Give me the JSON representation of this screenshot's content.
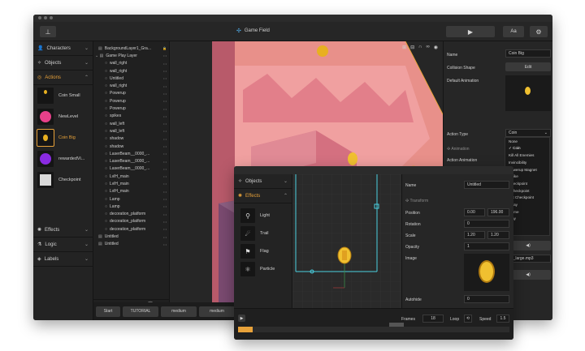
{
  "main": {
    "title": "Game Field",
    "left_panel": {
      "sections": [
        {
          "label": "Characters",
          "icon": "user-icon"
        },
        {
          "label": "Objects",
          "icon": "shapes-icon"
        },
        {
          "label": "Actions",
          "icon": "target-icon"
        }
      ],
      "actions": [
        "Coin Small",
        "NewLevel",
        "Coin Big",
        "rewardedVi...",
        "Checkpoint"
      ],
      "lower_sections": [
        {
          "label": "Effects",
          "icon": "effects-icon"
        },
        {
          "label": "Logic",
          "icon": "logic-icon"
        },
        {
          "label": "Labels",
          "icon": "tag-icon"
        }
      ]
    },
    "layers": [
      "BackgroundLayer1_Gra...",
      "Game Play Layer",
      "wall_right",
      "wall_right",
      "Untitled",
      "wall_right",
      "Powerup",
      "Powerup",
      "Powerup",
      "spikes",
      "wall_left",
      "wall_left",
      "shadow",
      "shadow",
      "LaserBeam__0000_...",
      "LaserBeam__0000_...",
      "LaserBeam__0000_...",
      "LvlH_main",
      "LvlH_main",
      "LvlH_main",
      "Lamp",
      "Lamp",
      "decoration_platform",
      "decoration_platform",
      "decoration_platform",
      "Untitled",
      "Untitled"
    ],
    "bottom_buttons": [
      "Start",
      "TUTORIAL",
      "medium",
      "medium"
    ],
    "properties": {
      "name_label": "Name",
      "name_value": "Coin Big",
      "collision_label": "Collision Shape",
      "collision_button": "Edit",
      "default_anim_label": "Default Animation",
      "action_type_label": "Action Type",
      "action_type_value": "Coin",
      "animation_label": "Animation",
      "action_anim_label": "Action Animation",
      "dropdown_options": [
        "None",
        "✓ Coin",
        "Kill All Enemies",
        "Invincibility",
        "Powerup Magnet",
        "Strike",
        "Checkpoint",
        "t Checkpoint",
        "tart Checkpoint",
        "eplay",
        "Game",
        "Play"
      ],
      "sound_file": "an_large.mp3"
    }
  },
  "effects_window": {
    "tabs": [
      {
        "label": "Objects",
        "icon": "shapes-icon"
      },
      {
        "label": "Effects",
        "icon": "effects-icon"
      }
    ],
    "effects": [
      {
        "label": "Light",
        "icon": "pin-icon"
      },
      {
        "label": "Trail",
        "icon": "trail-icon"
      },
      {
        "label": "Flag",
        "icon": "flag-icon"
      },
      {
        "label": "Particle",
        "icon": "atom-icon"
      }
    ],
    "properties": {
      "name_label": "Name",
      "name_value": "Untitled",
      "transform_label": "Transform",
      "position_label": "Position",
      "position_x": "0.00",
      "position_y": "196.00",
      "rotation_label": "Rotation",
      "rotation_value": "0",
      "scale_label": "Scale",
      "scale_x": "1.20",
      "scale_y": "1.20",
      "opacity_label": "Opacity",
      "opacity_value": "1",
      "image_label": "Image",
      "autohide_label": "Autohide",
      "autohide_value": "0"
    },
    "timeline": {
      "frames_label": "Frames",
      "frames_value": "18",
      "loop_label": "Loop",
      "speed_label": "Speed",
      "speed_value": "1.5"
    }
  },
  "colors": {
    "accent": "#e8a23a",
    "selection_cyan": "#49d0e0",
    "canvas_pink": "#e88a8a"
  }
}
